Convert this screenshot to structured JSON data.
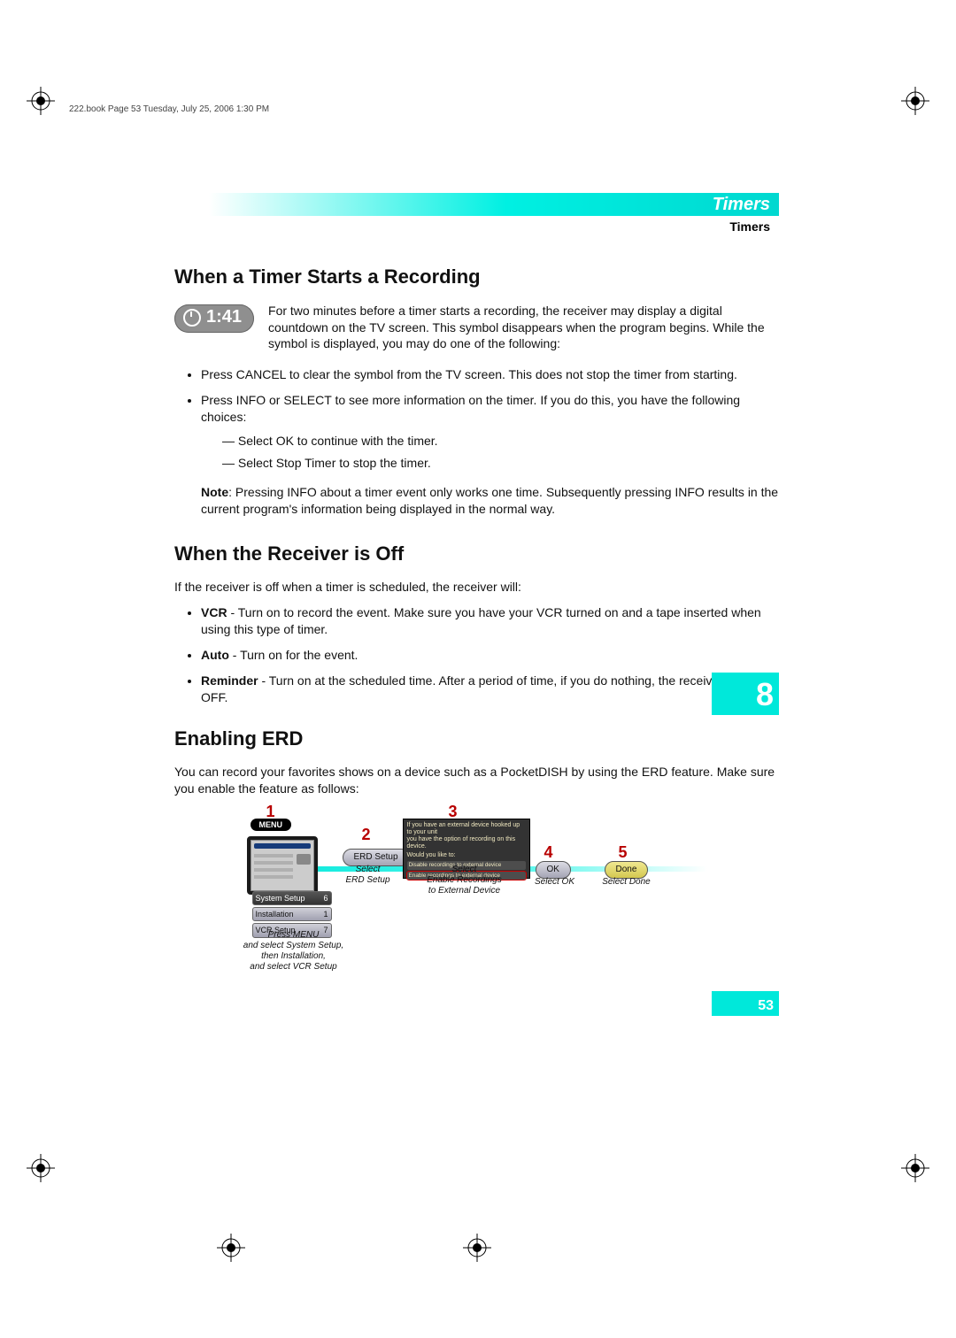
{
  "meta": {
    "book_line": "222.book  Page 53  Tuesday, July 25, 2006  1:30 PM"
  },
  "header": {
    "title": "Timers",
    "subtitle": "Timers"
  },
  "section1": {
    "heading": "When a Timer Starts a Recording",
    "badge_time": "1:41",
    "intro": "For two minutes before a timer starts a recording, the receiver may display a digital countdown on the TV screen. This symbol disappears when the program begins. While the symbol is displayed, you may do one of the following:",
    "bullets": [
      "Press CANCEL to clear the symbol from the TV screen. This does not stop the timer from starting.",
      "Press INFO or SELECT to see more information on the timer. If you do this, you have the following choices:"
    ],
    "dashes": [
      "Select OK to continue with the timer.",
      "Select Stop Timer to stop the timer."
    ],
    "note_label": "Note",
    "note_text": ": Pressing INFO about a timer event only works one time. Subsequently pressing INFO results in the current program's information being displayed in the normal way."
  },
  "section2": {
    "heading": "When the Receiver is Off",
    "intro": "If the receiver is off when a timer is scheduled, the receiver will:",
    "items": [
      {
        "label": "VCR",
        "text": " - Turn on to record the event. Make sure you have your VCR turned on and a tape inserted when using this type of timer."
      },
      {
        "label": "Auto",
        "text": " - Turn on for the event."
      },
      {
        "label": "Reminder",
        "text": " - Turn on at the scheduled time. After a period of time, if you do nothing, the receiver will turn OFF."
      }
    ]
  },
  "section3": {
    "heading": "Enabling ERD",
    "intro": "You can record your favorites shows on a device such as a PocketDISH by using the ERD feature. Make sure you enable the feature as follows:"
  },
  "erd": {
    "steps": {
      "n1": "1",
      "n2": "2",
      "n3": "3",
      "n4": "4",
      "n5": "5"
    },
    "menu_pill": "MENU",
    "menu_items": [
      {
        "label": "System Setup",
        "num": "6"
      },
      {
        "label": "Installation",
        "num": "1"
      },
      {
        "label": "VCR Setup",
        "num": "7"
      }
    ],
    "pills": {
      "erd": "ERD Setup",
      "ok": "OK",
      "done": "Done"
    },
    "dialog": {
      "line1": "If you have an external device hooked up to your unit",
      "line2": "you have the option of recording on this device.",
      "q": "Would you like to:",
      "opt1": "Disable recordings to external device",
      "opt2": "Enable recordings to external device"
    },
    "captions": {
      "c1": "Press MENU\nand select System Setup,\nthen Installation,\nand select VCR Setup",
      "c2": "Select\nERD Setup",
      "c3": "Select\nEnable Recordings\nto External Device",
      "c4": "Select OK",
      "c5": "Select Done"
    }
  },
  "tabs": {
    "chapter": "8",
    "page": "53"
  }
}
